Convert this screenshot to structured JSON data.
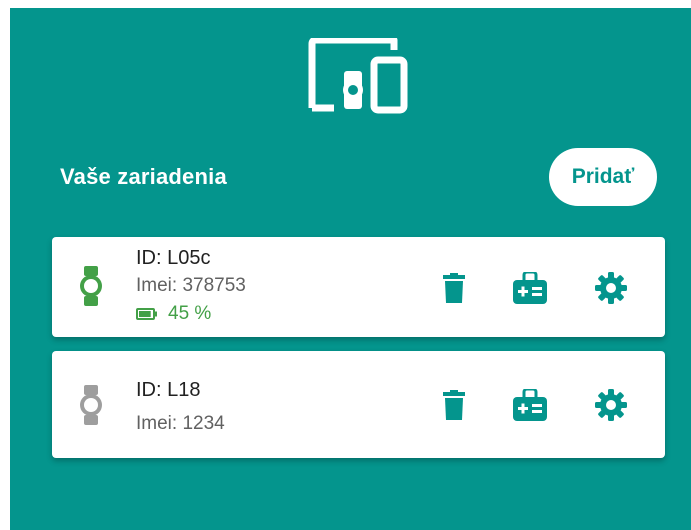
{
  "header": {
    "icon": "devices-icon",
    "title": "Vaše zariadenia",
    "add_label": "Pridať"
  },
  "colors": {
    "primary": "#04958d",
    "online": "#43a047",
    "offline": "#9e9e9e"
  },
  "devices": [
    {
      "id_label": "ID: L05c",
      "imei_label": "Imei: 378753",
      "battery_label": "45 %",
      "battery_level": 0.45,
      "status": "online"
    },
    {
      "id_label": "ID: L18",
      "imei_label": "Imei: 1234",
      "status": "offline"
    }
  ],
  "actions": [
    "delete-icon",
    "medical-card-icon",
    "settings-icon"
  ]
}
